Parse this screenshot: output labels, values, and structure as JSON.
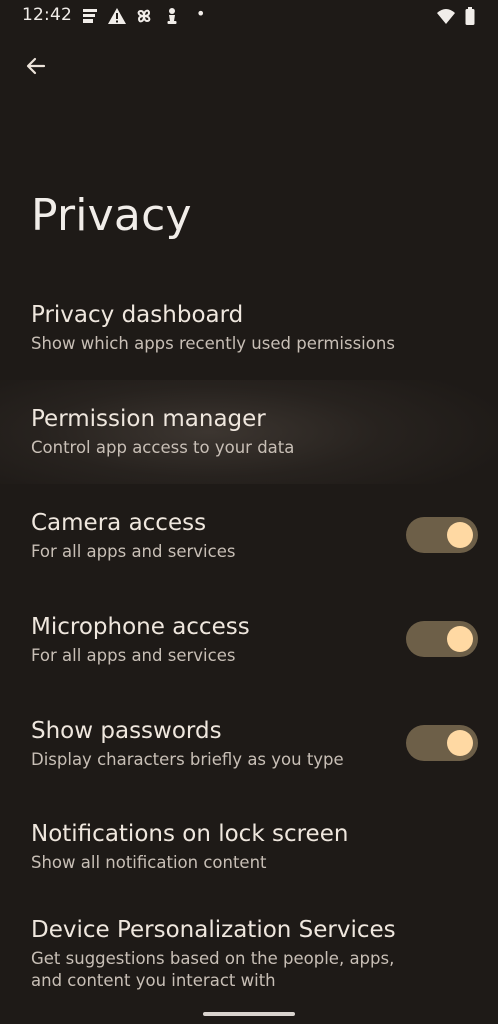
{
  "status_bar": {
    "time": "12:42",
    "dot": "•",
    "left_icons": [
      "notes-icon",
      "warning-icon",
      "pinwheel-icon",
      "chess-icon"
    ],
    "right_icons": [
      "wifi-icon",
      "battery-icon"
    ]
  },
  "header": {
    "back_icon": "arrow-back-icon",
    "title": "Privacy"
  },
  "items": [
    {
      "title": "Privacy dashboard",
      "subtitle": "Show which apps recently used permissions"
    },
    {
      "title": "Permission manager",
      "subtitle": "Control app access to your data"
    },
    {
      "title": "Camera access",
      "subtitle": "For all apps and services",
      "toggle": true
    },
    {
      "title": "Microphone access",
      "subtitle": "For all apps and services",
      "toggle": true
    },
    {
      "title": "Show passwords",
      "subtitle": "Display characters briefly as you type",
      "toggle": true
    },
    {
      "title": "Notifications on lock screen",
      "subtitle": "Show all notification content"
    },
    {
      "title": "Device Personalization Services",
      "subtitle": "Get suggestions based on the people, apps, and content you interact with"
    }
  ],
  "colors": {
    "background": "#1e1a17",
    "toggle_track_on": "#6d5f48",
    "toggle_thumb_on": "#ffd9a3"
  }
}
